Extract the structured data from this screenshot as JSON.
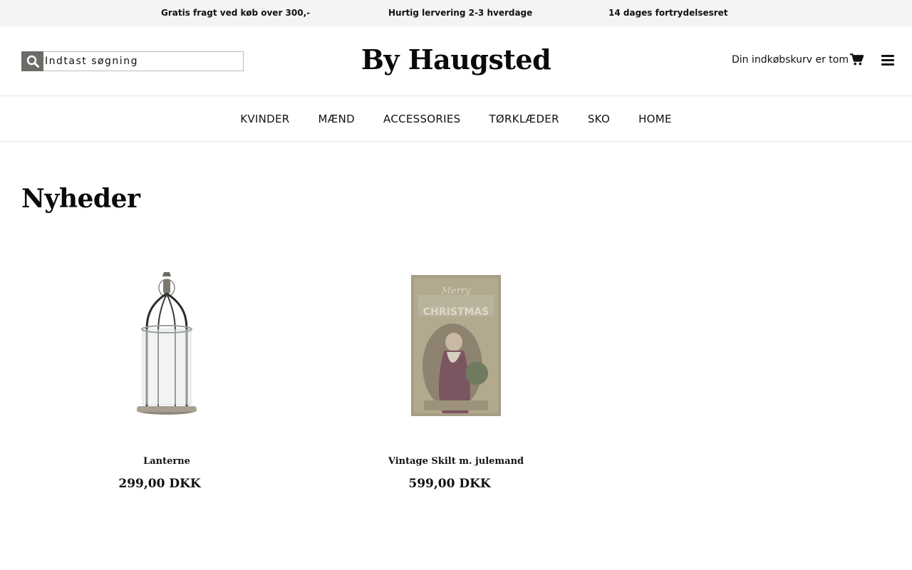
{
  "usp_bar": {
    "items": [
      "Gratis fragt ved køb over 300,-",
      "Hurtig lervering 2-3 hverdage",
      "14 dages fortrydelsesret"
    ]
  },
  "header": {
    "search_placeholder": "Indtast søgning",
    "logo": "By Haugsted",
    "cart_text": "Din indkøbskurv er tom"
  },
  "nav": {
    "items": [
      "KVINDER",
      "MÆND",
      "ACCESSORIES",
      "TØRKLÆDER",
      "SKO",
      "HOME"
    ]
  },
  "page": {
    "title": "Nyheder"
  },
  "products": [
    {
      "name": "Lanterne",
      "price": "299,00 DKK"
    },
    {
      "name": "Vintage Skilt m. julemand",
      "price": "599,00 DKK"
    }
  ],
  "colors": {
    "topbar_bg": "#f4f4f4",
    "search_button_bg": "#6b6b68",
    "text": "#111111"
  }
}
